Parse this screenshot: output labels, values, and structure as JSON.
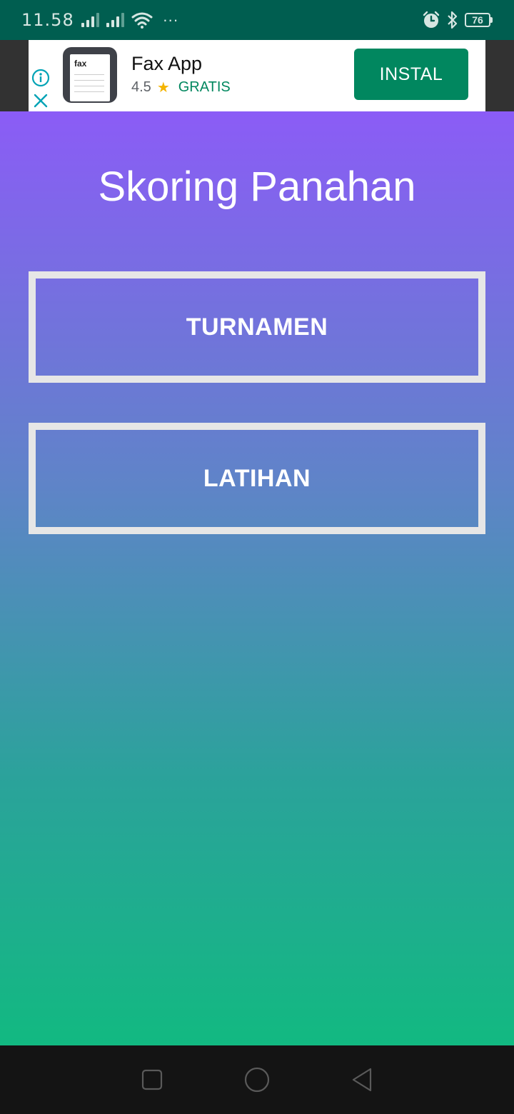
{
  "status_bar": {
    "time": "11.58",
    "more_indicator": "···",
    "battery_level": "76",
    "icons": [
      "signal-icon",
      "signal-icon",
      "wifi-icon",
      "alarm-icon",
      "bluetooth-icon",
      "battery-icon"
    ]
  },
  "ad": {
    "app_name": "Fax App",
    "rating": "4.5",
    "price": "GRATIS",
    "install_label": "INSTAL",
    "icon_text": "fax",
    "colors": {
      "install_bg": "#01875f",
      "price": "#01875f",
      "star": "#f4b400",
      "info": "#00a3b5"
    }
  },
  "main": {
    "title": "Skoring Panahan",
    "buttons": [
      {
        "label": "TURNAMEN"
      },
      {
        "label": "LATIHAN"
      }
    ],
    "colors": {
      "gradient_top": "#8b5cf6",
      "gradient_bottom": "#12b981",
      "button_border": "#e6e6e6"
    }
  },
  "nav_bar": {
    "icons": [
      "recent-apps-icon",
      "home-icon",
      "back-icon"
    ]
  }
}
